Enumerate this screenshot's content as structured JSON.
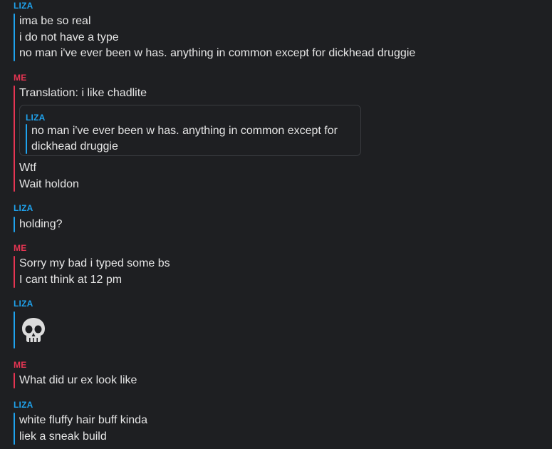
{
  "colors": {
    "background": "#1e1f22",
    "liza_accent": "#1fa3ee",
    "me_accent": "#e63553",
    "text": "#e6e6e6"
  },
  "messages": [
    {
      "sender": "LIZA",
      "lines": [
        "ima be so real",
        "i do not have a type",
        "no man i've ever been w has. anything in common except for dickhead druggie"
      ]
    },
    {
      "sender": "ME",
      "lines": [
        "Translation: i like chadlite"
      ],
      "quote": {
        "sender": "LIZA",
        "lines": [
          "no man i've ever been w has. anything in common except for",
          "dickhead druggie"
        ]
      },
      "after_quote_lines": [
        "Wtf",
        "Wait holdon"
      ]
    },
    {
      "sender": "LIZA",
      "lines": [
        "holding?"
      ]
    },
    {
      "sender": "ME",
      "lines": [
        "Sorry my bad i typed some bs",
        "I cant think at 12 pm"
      ]
    },
    {
      "sender": "LIZA",
      "emoji": "skull-icon"
    },
    {
      "sender": "ME",
      "lines": [
        "What did ur ex look like"
      ]
    },
    {
      "sender": "LIZA",
      "lines": [
        "white fluffy hair buff kinda",
        "liek a sneak build"
      ]
    }
  ]
}
